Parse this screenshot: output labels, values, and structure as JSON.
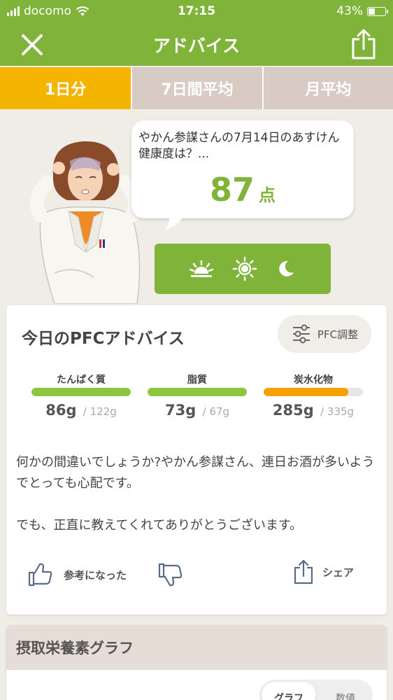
{
  "status_bar": {
    "carrier": "docomo",
    "time": "17:15",
    "battery": "43%",
    "battery_level": 0.43
  },
  "nav": {
    "title": "アドバイス"
  },
  "tabs": [
    {
      "label": "1日分",
      "active": true
    },
    {
      "label": "7日間平均",
      "active": false
    },
    {
      "label": "月平均",
      "active": false
    }
  ],
  "bubble": {
    "message": "やかん参謀さんの7月14日のあすけん健康度は？...",
    "score": "87",
    "score_unit": "点"
  },
  "card": {
    "title": "今日のPFCアドバイス",
    "pfc_button": "PFC調整"
  },
  "nutrients": [
    {
      "label": "たんぱく質",
      "value": "86g",
      "target": "/ 122g",
      "ratio": 1.0,
      "color": "#8cc63f"
    },
    {
      "label": "脂質",
      "value": "73g",
      "target": "/ 67g",
      "ratio": 1.0,
      "color": "#8cc63f"
    },
    {
      "label": "炭水化物",
      "value": "285g",
      "target": "/ 335g",
      "ratio": 0.85,
      "color": "#f5a100"
    }
  ],
  "advice": {
    "p1": "何かの間違いでしょうか?やかん参謀さん、連日お酒が多いようでとっても心配です。",
    "p2": "でも、正直に教えてくれてありがとうございます。"
  },
  "actions": {
    "helpful": "参考になった",
    "share": "シェア"
  },
  "card2": {
    "title": "摂取栄養素グラフ",
    "seg_graph": "グラフ",
    "seg_value": "数値"
  },
  "colors": {
    "brand_green": "#80b33a",
    "tab_active": "#f5b400",
    "tab_inactive": "#d8cbc4"
  }
}
